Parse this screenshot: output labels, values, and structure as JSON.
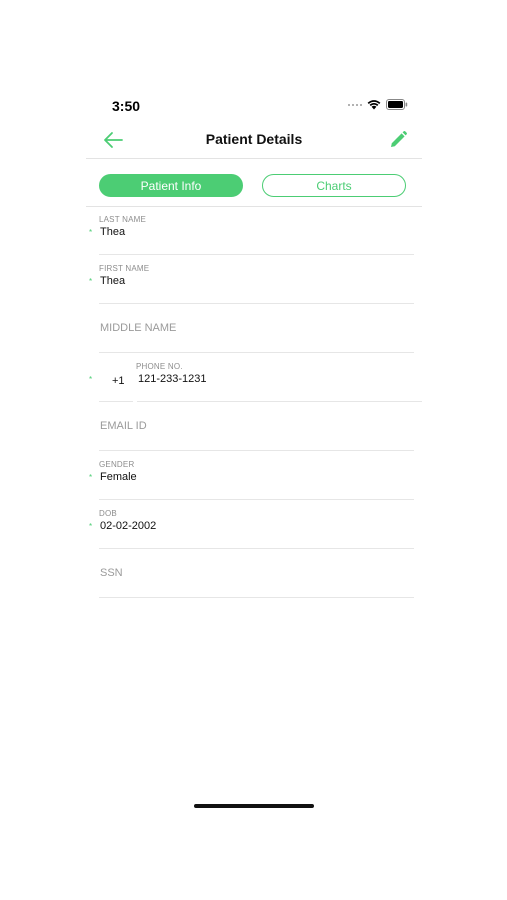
{
  "status_bar": {
    "time": "3:50",
    "icons": [
      "signal-icon",
      "wifi-icon",
      "battery-icon"
    ]
  },
  "nav": {
    "title": "Patient Details",
    "back_icon": "back-arrow-icon",
    "edit_icon": "pencil-edit-icon"
  },
  "tabs": [
    {
      "label": "Patient Info",
      "active": true
    },
    {
      "label": "Charts",
      "active": false
    }
  ],
  "fields": {
    "last_name": {
      "label": "LAST NAME",
      "value": "Thea",
      "required": "*"
    },
    "first_name": {
      "label": "FIRST NAME",
      "value": "Thea",
      "required": "*"
    },
    "middle_name": {
      "placeholder": "MIDDLE NAME"
    },
    "phone": {
      "label": "PHONE NO.",
      "code": "+1",
      "value": "121-233-1231",
      "required": "*"
    },
    "email": {
      "placeholder": "EMAIL ID"
    },
    "gender": {
      "label": "GENDER",
      "value": "Female",
      "required": "*"
    },
    "dob": {
      "label": "DOB",
      "value": "02-02-2002",
      "required": "*"
    },
    "ssn": {
      "placeholder": "SSN"
    }
  },
  "colors": {
    "accent": "#4ccd74",
    "text": "#111111",
    "label": "#8d8d8d",
    "divider": "#e6e6e6"
  }
}
